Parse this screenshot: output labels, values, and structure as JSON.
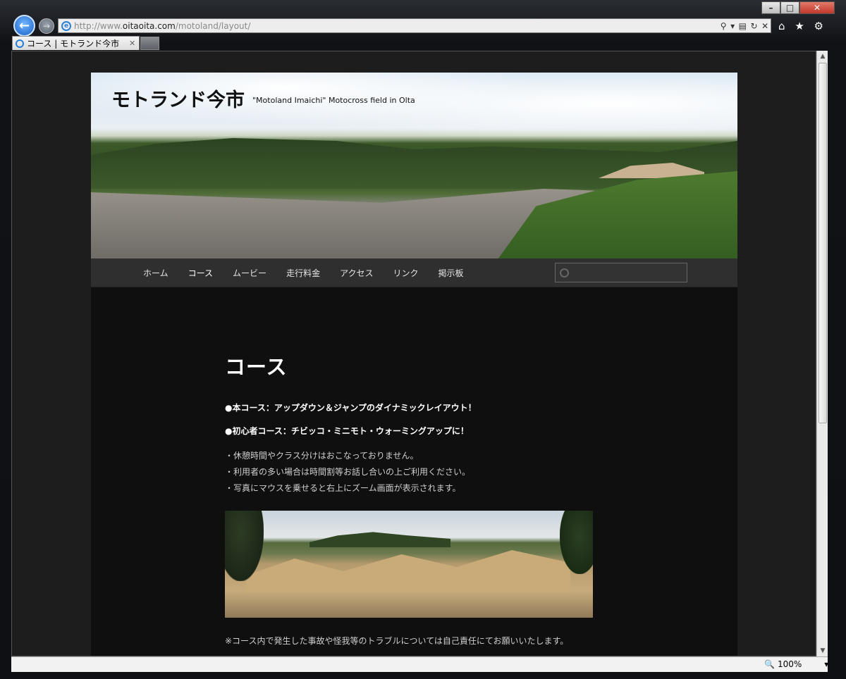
{
  "browser": {
    "address": {
      "prefix": "http://www.",
      "domain": "oitaoita.com",
      "path": "/motoland/layout/"
    },
    "tab_title": "コース | モトランド今市",
    "status": {
      "zoom": "100%"
    }
  },
  "site": {
    "title": "モトランド今市",
    "description": "\"Motoland Imaichi\" Motocross field in Olta"
  },
  "nav": {
    "items": [
      {
        "label": "ホーム",
        "current": false
      },
      {
        "label": "コース",
        "current": true
      },
      {
        "label": "ムービー",
        "current": false
      },
      {
        "label": "走行料金",
        "current": false
      },
      {
        "label": "アクセス",
        "current": false
      },
      {
        "label": "リンク",
        "current": false
      },
      {
        "label": "掲示板",
        "current": false
      }
    ],
    "search_placeholder": ""
  },
  "content": {
    "title": "コース",
    "lead1": "●本コース：アップダウン＆ジャンプのダイナミックレイアウト！",
    "lead2": "●初心者コース：チビッコ・ミニモト・ウォーミングアップに！",
    "notes": [
      "・休憩時間やクラス分けはおこなっておりません。",
      "・利用者の多い場合は時間割等お話し合いの上ご利用ください。",
      "・写真にマウスを乗せると右上にズーム画面が表示されます。"
    ],
    "footnote": "※コース内で発生した事故や怪我等のトラブルについては自己責任にてお願いいたします。"
  },
  "colors": {
    "page_bg": "#0f0f0f",
    "nav_bg": "#2f2f2f",
    "frame_bg": "#1d1d1d"
  }
}
